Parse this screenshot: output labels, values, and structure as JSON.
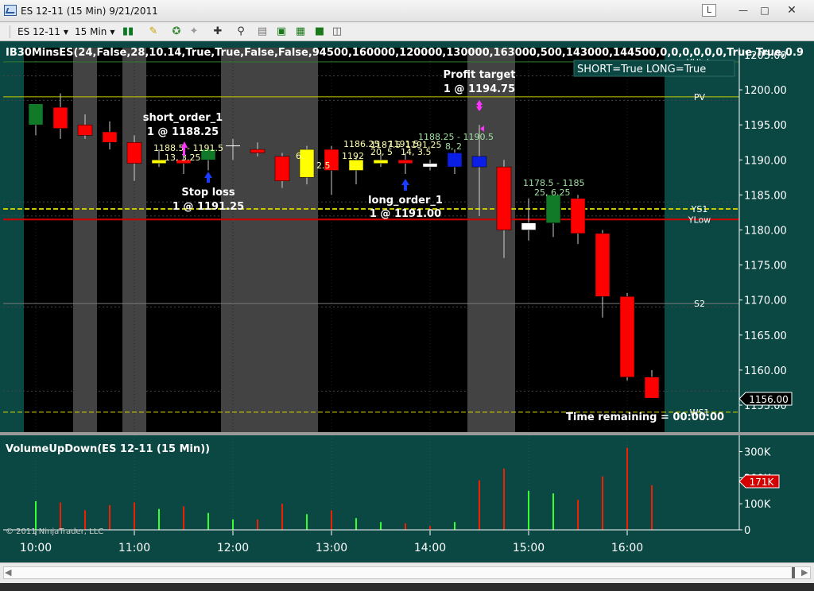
{
  "window": {
    "title": "ES 12-11 (15 Min)  9/21/2011",
    "l_label": "L",
    "minimize": "—",
    "maximize": "□",
    "close": "✕"
  },
  "toolbar": {
    "instrument": "ES 12-11",
    "interval": "15 Min"
  },
  "chart": {
    "indicator_label": "IB30MinsES(24,False,28,10.14,True,True,False,False,94500,160000,120000,130000,163000,500,143000,144500,0,0,0,0,0,0,True,True,0.9",
    "short_long_label": "SHORT=True LONG=True",
    "time_remaining": "Time remaining = 00:00:00",
    "last_price": "1156.00",
    "copyright": "© 2011 NinjaTrader, LLC",
    "volume_title": "VolumeUpDown(ES 12-11 (15 Min))",
    "volume_last": "171K",
    "x_ticks": [
      "10:00",
      "11:00",
      "12:00",
      "13:00",
      "14:00",
      "15:00",
      "16:00"
    ],
    "price_ticks": [
      "1205.00",
      "1200.00",
      "1195.00",
      "1190.00",
      "1185.00",
      "1180.00",
      "1175.00",
      "1170.00",
      "1165.00",
      "1160.00",
      "1155.00"
    ],
    "vol_ticks": [
      "300K",
      "200K",
      "100K",
      "0"
    ],
    "level_labels": [
      "YHigh",
      "PV",
      "YS1",
      "YLow",
      "S2",
      "WS1"
    ],
    "orders": {
      "short_order_name": "short_order_1",
      "short_order_price": "1 @ 1188.25",
      "stop_name": "Stop loss",
      "stop_price": "1 @ 1191.25",
      "long_order_name": "long_order_1",
      "long_order_price": "1 @ 1191.00",
      "target_name": "Profit target",
      "target_price": "1 @ 1194.75"
    },
    "range_labels": [
      "1188.5 - 1191.5",
      "13, 3.25",
      "6.",
      "2.5",
      "1192",
      "1186.25 - 1191.5",
      "20, 5",
      "1187.5",
      "14, 3.5",
      "1191.25",
      "1188.25 - 1190.5",
      "8, 2",
      "1178.5 - 1185",
      "25, 6.25"
    ]
  },
  "colors": {
    "up": "#107a28",
    "down": "#ff0000",
    "ib_yellow": "#ffff00",
    "ib_blue": "#0a1ee6",
    "ib_white": "#ffffff",
    "session_bg": "#000000",
    "out_bg": "#0b4843",
    "gray_band": "#434343"
  },
  "chart_data": {
    "type": "candlestick",
    "title": "ES 12-11 (15 Min)  9/21/2011",
    "ylim": [
      1155,
      1205
    ],
    "x_labels": [
      "10:00",
      "11:00",
      "12:00",
      "13:00",
      "14:00",
      "15:00",
      "16:00"
    ],
    "candles": [
      {
        "time": "9:45",
        "o": 1195,
        "h": 1198,
        "l": 1193.5,
        "c": 1198,
        "color": "green"
      },
      {
        "time": "10:00",
        "o": 1197.5,
        "h": 1199.5,
        "l": 1193,
        "c": 1194.5,
        "color": "red"
      },
      {
        "time": "10:15",
        "o": 1195,
        "h": 1196.5,
        "l": 1193,
        "c": 1193.5,
        "color": "red"
      },
      {
        "time": "10:30",
        "o": 1194,
        "h": 1195.5,
        "l": 1191.5,
        "c": 1192.5,
        "color": "red"
      },
      {
        "time": "10:45",
        "o": 1192.5,
        "h": 1193.5,
        "l": 1187,
        "c": 1189.5,
        "color": "red"
      },
      {
        "time": "11:00",
        "o": 1190,
        "h": 1191.5,
        "l": 1189,
        "c": 1189.5,
        "color": "yellow"
      },
      {
        "time": "11:15",
        "o": 1190,
        "h": 1191.5,
        "l": 1188,
        "c": 1189.5,
        "color": "red"
      },
      {
        "time": "11:30",
        "o": 1190,
        "h": 1192,
        "l": 1188.5,
        "c": 1191.5,
        "color": "green"
      },
      {
        "time": "11:45",
        "o": 1192,
        "h": 1193,
        "l": 1190,
        "c": 1192,
        "color": "doji"
      },
      {
        "time": "12:00",
        "o": 1191.5,
        "h": 1192.5,
        "l": 1190.5,
        "c": 1191,
        "color": "red"
      },
      {
        "time": "12:15",
        "o": 1190.5,
        "h": 1191,
        "l": 1186,
        "c": 1187,
        "color": "red"
      },
      {
        "time": "12:30",
        "o": 1187.5,
        "h": 1192,
        "l": 1186.5,
        "c": 1191.5,
        "color": "yellow"
      },
      {
        "time": "12:45",
        "o": 1191.5,
        "h": 1192,
        "l": 1185,
        "c": 1188.5,
        "color": "red"
      },
      {
        "time": "13:00",
        "o": 1188.5,
        "h": 1190.5,
        "l": 1186.5,
        "c": 1190,
        "color": "yellow"
      },
      {
        "time": "13:15",
        "o": 1190,
        "h": 1191,
        "l": 1189,
        "c": 1189.5,
        "color": "yellow"
      },
      {
        "time": "13:30",
        "o": 1189.5,
        "h": 1191,
        "l": 1188,
        "c": 1190,
        "color": "red"
      },
      {
        "time": "13:45",
        "o": 1189,
        "h": 1190,
        "l": 1188.5,
        "c": 1189.5,
        "color": "white"
      },
      {
        "time": "14:00",
        "o": 1191,
        "h": 1191.5,
        "l": 1188,
        "c": 1189,
        "color": "blue"
      },
      {
        "time": "14:15",
        "o": 1190.5,
        "h": 1195,
        "l": 1182,
        "c": 1189,
        "color": "blue"
      },
      {
        "time": "14:30",
        "o": 1189,
        "h": 1190,
        "l": 1176,
        "c": 1180,
        "color": "red"
      },
      {
        "time": "14:45",
        "o": 1180,
        "h": 1184.5,
        "l": 1178.5,
        "c": 1181,
        "color": "white"
      },
      {
        "time": "15:00",
        "o": 1181,
        "h": 1185,
        "l": 1179,
        "c": 1185,
        "color": "green"
      },
      {
        "time": "15:15",
        "o": 1184.5,
        "h": 1185,
        "l": 1178,
        "c": 1179.5,
        "color": "red"
      },
      {
        "time": "15:30",
        "o": 1179.5,
        "h": 1180,
        "l": 1167.5,
        "c": 1170.5,
        "color": "red"
      },
      {
        "time": "15:45",
        "o": 1170.5,
        "h": 1171,
        "l": 1158.5,
        "c": 1159,
        "color": "red"
      },
      {
        "time": "16:00",
        "o": 1159,
        "h": 1160,
        "l": 1156,
        "c": 1156,
        "color": "red"
      }
    ],
    "levels": [
      {
        "name": "YHigh",
        "price": 1204
      },
      {
        "name": "PV",
        "price": 1199
      },
      {
        "name": "YS1",
        "price": 1183
      },
      {
        "name": "YLow",
        "price": 1181.5
      },
      {
        "name": "S2",
        "price": 1169.5
      },
      {
        "name": "WS1",
        "price": 1154
      }
    ],
    "volume": {
      "ylim": [
        0,
        320
      ],
      "unit": "K",
      "bars": [
        {
          "time": "9:45",
          "v": 110,
          "dir": "up"
        },
        {
          "time": "10:00",
          "v": 105,
          "dir": "down"
        },
        {
          "time": "10:15",
          "v": 75,
          "dir": "down"
        },
        {
          "time": "10:30",
          "v": 95,
          "dir": "down"
        },
        {
          "time": "10:45",
          "v": 105,
          "dir": "down"
        },
        {
          "time": "11:00",
          "v": 80,
          "dir": "up"
        },
        {
          "time": "11:15",
          "v": 90,
          "dir": "down"
        },
        {
          "time": "11:30",
          "v": 65,
          "dir": "up"
        },
        {
          "time": "11:45",
          "v": 40,
          "dir": "up"
        },
        {
          "time": "12:00",
          "v": 40,
          "dir": "down"
        },
        {
          "time": "12:15",
          "v": 100,
          "dir": "down"
        },
        {
          "time": "12:30",
          "v": 60,
          "dir": "up"
        },
        {
          "time": "12:45",
          "v": 75,
          "dir": "down"
        },
        {
          "time": "13:00",
          "v": 45,
          "dir": "up"
        },
        {
          "time": "13:15",
          "v": 30,
          "dir": "up"
        },
        {
          "time": "13:30",
          "v": 25,
          "dir": "down"
        },
        {
          "time": "13:45",
          "v": 15,
          "dir": "down"
        },
        {
          "time": "14:00",
          "v": 30,
          "dir": "up"
        },
        {
          "time": "14:15",
          "v": 190,
          "dir": "down"
        },
        {
          "time": "14:30",
          "v": 235,
          "dir": "down"
        },
        {
          "time": "14:45",
          "v": 150,
          "dir": "up"
        },
        {
          "time": "15:00",
          "v": 140,
          "dir": "up"
        },
        {
          "time": "15:15",
          "v": 115,
          "dir": "down"
        },
        {
          "time": "15:30",
          "v": 205,
          "dir": "down"
        },
        {
          "time": "15:45",
          "v": 315,
          "dir": "down"
        },
        {
          "time": "16:00",
          "v": 171,
          "dir": "down"
        }
      ]
    }
  }
}
